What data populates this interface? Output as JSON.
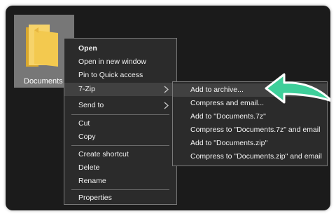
{
  "folder": {
    "label": "Documents",
    "icon": "folder-icon"
  },
  "context_menu": {
    "open": "Open",
    "open_new_window": "Open in new window",
    "pin_quick_access": "Pin to Quick access",
    "seven_zip": "7-Zip",
    "send_to": "Send to",
    "cut": "Cut",
    "copy": "Copy",
    "create_shortcut": "Create shortcut",
    "delete": "Delete",
    "rename": "Rename",
    "properties": "Properties"
  },
  "submenu": {
    "add_to_archive": "Add to archive...",
    "compress_email": "Compress and email...",
    "add_7z": "Add to \"Documents.7z\"",
    "compress_7z_email": "Compress to \"Documents.7z\" and email",
    "add_zip": "Add to \"Documents.zip\"",
    "compress_zip_email": "Compress to \"Documents.zip\" and email"
  },
  "colors": {
    "accent_arrow": "#3ecf9a",
    "menu_bg": "#2b2b2b",
    "folder_yellow": "#f3c94f"
  }
}
